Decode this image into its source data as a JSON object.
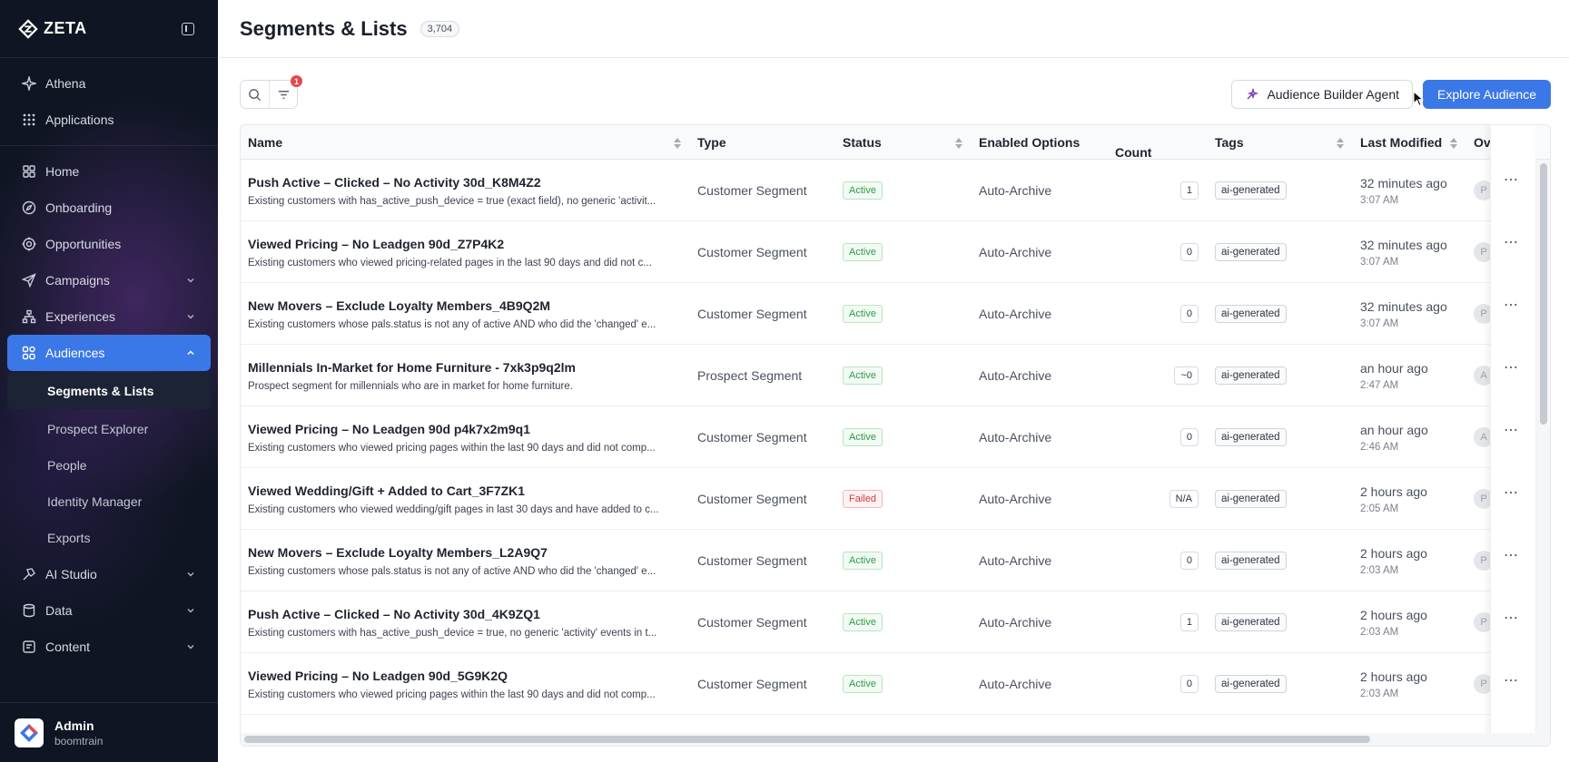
{
  "brand": {
    "name": "ZETA"
  },
  "sidebar": {
    "top": [
      {
        "label": "Athena",
        "icon": "sparkle-icon"
      },
      {
        "label": "Applications",
        "icon": "grid-dots-icon"
      }
    ],
    "main": [
      {
        "label": "Home",
        "icon": "home-icon"
      },
      {
        "label": "Onboarding",
        "icon": "compass-icon"
      },
      {
        "label": "Opportunities",
        "icon": "target-icon"
      },
      {
        "label": "Campaigns",
        "icon": "send-icon"
      },
      {
        "label": "Experiences",
        "icon": "hierarchy-icon"
      },
      {
        "label": "Audiences",
        "icon": "audiences-icon"
      }
    ],
    "sub": [
      {
        "label": "Segments & Lists"
      },
      {
        "label": "Prospect Explorer"
      },
      {
        "label": "People"
      },
      {
        "label": "Identity Manager"
      },
      {
        "label": "Exports"
      }
    ],
    "bottom": [
      {
        "label": "AI Studio",
        "icon": "ai-studio-icon"
      },
      {
        "label": "Data",
        "icon": "database-icon"
      },
      {
        "label": "Content",
        "icon": "content-icon"
      }
    ],
    "user": {
      "name": "Admin",
      "org": "boomtrain"
    }
  },
  "header": {
    "title": "Segments & Lists",
    "count": "3,704"
  },
  "toolbar": {
    "filter_badge": "1",
    "agent_label": "Audience Builder Agent",
    "explore_label": "Explore Audience"
  },
  "table": {
    "columns": {
      "name": "Name",
      "type": "Type",
      "status": "Status",
      "enabled": "Enabled Options",
      "count": "Count",
      "tags": "Tags",
      "modified": "Last Modified",
      "owner": "Ov"
    },
    "rows": [
      {
        "name": "Push Active – Clicked – No Activity 30d_K8M4Z2",
        "desc": "Existing customers with has_active_push_device = true (exact field), no generic 'activit...",
        "type": "Customer Segment",
        "status": "Active",
        "enabled": "Auto-Archive",
        "count": "1",
        "tag": "ai-generated",
        "rel": "32 minutes ago",
        "time": "3:07 AM",
        "owner": "P"
      },
      {
        "name": "Viewed Pricing – No Leadgen 90d_Z7P4K2",
        "desc": "Existing customers who viewed pricing-related pages in the last 90 days and did not c...",
        "type": "Customer Segment",
        "status": "Active",
        "enabled": "Auto-Archive",
        "count": "0",
        "tag": "ai-generated",
        "rel": "32 minutes ago",
        "time": "3:07 AM",
        "owner": "P"
      },
      {
        "name": "New Movers – Exclude Loyalty Members_4B9Q2M",
        "desc": "Existing customers whose pals.status is not any of active AND who did the 'changed' e...",
        "type": "Customer Segment",
        "status": "Active",
        "enabled": "Auto-Archive",
        "count": "0",
        "tag": "ai-generated",
        "rel": "32 minutes ago",
        "time": "3:07 AM",
        "owner": "P"
      },
      {
        "name": "Millennials In-Market for Home Furniture - 7xk3p9q2lm",
        "desc": "Prospect segment for millennials who are in market for home furniture.",
        "type": "Prospect Segment",
        "status": "Active",
        "enabled": "Auto-Archive",
        "count": "~0",
        "tag": "ai-generated",
        "rel": "an hour ago",
        "time": "2:47 AM",
        "owner": "A"
      },
      {
        "name": "Viewed Pricing – No Leadgen 90d p4k7x2m9q1",
        "desc": "Existing customers who viewed pricing pages within the last 90 days and did not comp...",
        "type": "Customer Segment",
        "status": "Active",
        "enabled": "Auto-Archive",
        "count": "0",
        "tag": "ai-generated",
        "rel": "an hour ago",
        "time": "2:46 AM",
        "owner": "A"
      },
      {
        "name": "Viewed Wedding/Gift + Added to Cart_3F7ZK1",
        "desc": "Existing customers who viewed wedding/gift pages in last 30 days and have added to c...",
        "type": "Customer Segment",
        "status": "Failed",
        "enabled": "Auto-Archive",
        "count": "N/A",
        "tag": "ai-generated",
        "rel": "2 hours ago",
        "time": "2:05 AM",
        "owner": "P"
      },
      {
        "name": "New Movers – Exclude Loyalty Members_L2A9Q7",
        "desc": "Existing customers whose pals.status is not any of active AND who did the 'changed' e...",
        "type": "Customer Segment",
        "status": "Active",
        "enabled": "Auto-Archive",
        "count": "0",
        "tag": "ai-generated",
        "rel": "2 hours ago",
        "time": "2:03 AM",
        "owner": "P"
      },
      {
        "name": "Push Active – Clicked – No Activity 30d_4K9ZQ1",
        "desc": "Existing customers with has_active_push_device = true, no generic 'activity' events in t...",
        "type": "Customer Segment",
        "status": "Active",
        "enabled": "Auto-Archive",
        "count": "1",
        "tag": "ai-generated",
        "rel": "2 hours ago",
        "time": "2:03 AM",
        "owner": "P"
      },
      {
        "name": "Viewed Pricing – No Leadgen 90d_5G9K2Q",
        "desc": "Existing customers who viewed pricing pages within the last 90 days and did not comp...",
        "type": "Customer Segment",
        "status": "Active",
        "enabled": "Auto-Archive",
        "count": "0",
        "tag": "ai-generated",
        "rel": "2 hours ago",
        "time": "2:03 AM",
        "owner": "P"
      }
    ]
  },
  "colors": {
    "accent": "#3b78e7",
    "sidebar_bg": "#0f1522",
    "active_green": "#2f9a4b",
    "failed_red": "#d23b3b"
  }
}
